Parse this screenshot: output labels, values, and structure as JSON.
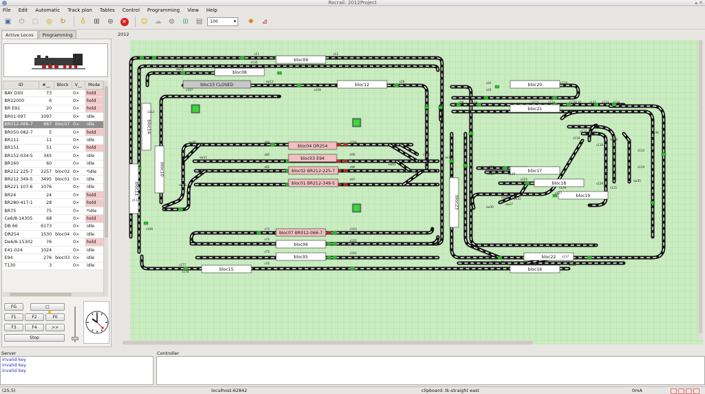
{
  "window": {
    "title": "Rocrail: 2012Project"
  },
  "menu": [
    "File",
    "Edit",
    "Automatic",
    "Track plan",
    "Tables",
    "Control",
    "Programming",
    "View",
    "Help"
  ],
  "toolbar": {
    "speed_value": "100"
  },
  "left_tabs": [
    "Active Locos",
    "Programming"
  ],
  "loco_table": {
    "headers": [
      "ID",
      "#__",
      "Block",
      "V__",
      "Mode"
    ],
    "rows": [
      {
        "id": "BAY DXII",
        "num": "73",
        "block": "",
        "v": "0>",
        "mode": "hold"
      },
      {
        "id": "BR12000",
        "num": "6",
        "block": "",
        "v": "0>",
        "mode": "hold"
      },
      {
        "id": "BR E91",
        "num": "20",
        "block": "",
        "v": "0>",
        "mode": "hold"
      },
      {
        "id": "BR01-097",
        "num": "1097",
        "block": "",
        "v": "0>",
        "mode": "idle"
      },
      {
        "id": "BR012-066-7",
        "num": "667",
        "block": "bloc07",
        "v": "0>",
        "mode": "idle"
      },
      {
        "id": "BR050-082-7",
        "num": "5",
        "block": "",
        "v": "0>",
        "mode": "hold"
      },
      {
        "id": "BR111",
        "num": "11",
        "block": "",
        "v": "0>",
        "mode": "idle"
      },
      {
        "id": "BR151",
        "num": "51",
        "block": "",
        "v": "0>",
        "mode": "hold"
      },
      {
        "id": "BR152-034-5",
        "num": "345",
        "block": "",
        "v": "0>",
        "mode": "idle"
      },
      {
        "id": "BR160",
        "num": "60",
        "block": "",
        "v": "0>",
        "mode": "idle"
      },
      {
        "id": "BR212 225-7",
        "num": "2257",
        "block": "bloc02",
        "v": "0>",
        "mode": "*idle"
      },
      {
        "id": "BR212 349-5",
        "num": "3495",
        "block": "bloc01",
        "v": "0>",
        "mode": "idle"
      },
      {
        "id": "BR221 107-6",
        "num": "1076",
        "block": "",
        "v": "0>",
        "mode": "idle"
      },
      {
        "id": "BR24",
        "num": "24",
        "block": "",
        "v": "0>",
        "mode": "hold"
      },
      {
        "id": "BR280-417-1",
        "num": "28",
        "block": "",
        "v": "0>",
        "mode": "hold"
      },
      {
        "id": "BR75",
        "num": "75",
        "block": "",
        "v": "0>",
        "mode": "*idle"
      },
      {
        "id": "Ce6/8-14305",
        "num": "68",
        "block": "",
        "v": "0>",
        "mode": "hold"
      },
      {
        "id": "DB 66",
        "num": "6173",
        "block": "",
        "v": "0>",
        "mode": "idle"
      },
      {
        "id": "DR254",
        "num": "1530",
        "block": "bloc04",
        "v": "0>",
        "mode": "idle"
      },
      {
        "id": "De6/6-15302",
        "num": "76",
        "block": "",
        "v": "0>",
        "mode": "hold"
      },
      {
        "id": "E41-024",
        "num": "1024",
        "block": "",
        "v": "0>",
        "mode": "idle"
      },
      {
        "id": "E94",
        "num": "276",
        "block": "bloc03",
        "v": "0>",
        "mode": "idle"
      },
      {
        "id": "T130",
        "num": "3",
        "block": "",
        "v": "0>",
        "mode": "idle"
      }
    ],
    "selected_index": 4
  },
  "controls": {
    "fg": "FG",
    "f1": "F1",
    "f2": "F2",
    "f0": "F0",
    "f3": "F3",
    "f4": "F4",
    "next": ">>",
    "stop": "Stop"
  },
  "plan": {
    "tab": "2012",
    "blocks": [
      {
        "id": "bloc09",
        "label": "bloc09",
        "state": "free"
      },
      {
        "id": "bloc08",
        "label": "bloc08",
        "state": "free"
      },
      {
        "id": "bloc13",
        "label": "bloc13 CLOSED",
        "state": "closed"
      },
      {
        "id": "bloc12",
        "label": "bloc12",
        "state": "free"
      },
      {
        "id": "bloc20",
        "label": "bloc20",
        "state": "free"
      },
      {
        "id": "bloc21",
        "label": "bloc21",
        "state": "free"
      },
      {
        "id": "bloc14",
        "label": "bloc14",
        "state": "free"
      },
      {
        "id": "bloc10",
        "label": "bloc10",
        "state": "free"
      },
      {
        "id": "bloc11",
        "label": "bloc11",
        "state": "free"
      },
      {
        "id": "bloc04",
        "label": "bloc04 DR254",
        "state": "occupied"
      },
      {
        "id": "bloc03",
        "label": "bloc03 E94",
        "state": "occupied"
      },
      {
        "id": "bloc02",
        "label": "bloc02 BR212-225-7",
        "state": "occupied"
      },
      {
        "id": "bloc01",
        "label": "bloc01 BR212-349-5",
        "state": "occupied"
      },
      {
        "id": "bloc07",
        "label": "bloc07 BR012-066-7",
        "state": "occupied"
      },
      {
        "id": "bloc06",
        "label": "bloc06",
        "state": "free"
      },
      {
        "id": "bloc05",
        "label": "bloc05",
        "state": "free"
      },
      {
        "id": "bloc15",
        "label": "bloc15",
        "state": "free"
      },
      {
        "id": "bloc23",
        "label": "bloc23",
        "state": "free"
      },
      {
        "id": "bloc17",
        "label": "bloc17",
        "state": "free"
      },
      {
        "id": "bloc18",
        "label": "bloc18",
        "state": "free"
      },
      {
        "id": "bloc19",
        "label": "bloc19",
        "state": "free"
      },
      {
        "id": "bloc22",
        "label": "bloc22",
        "state": "free"
      },
      {
        "id": "bloc16",
        "label": "bloc16",
        "state": "free"
      }
    ],
    "labels": {
      "s12": "s12",
      "s11": "s11",
      "s135": "s135",
      "sw14": "sw14",
      "s107": "s107",
      "sw13": "sw13",
      "s109": "s109",
      "s18": "s18",
      "s29": "s29",
      "s20": "s20",
      "s120": "s120",
      "s28": "s28",
      "s24": "s24",
      "sw06": "sw06",
      "sw11": "sw11",
      "sw16": "sw16",
      "s104": "s104",
      "s99": "s99",
      "s98": "s98",
      "s97": "s97",
      "s103": "s103",
      "s102": "s102",
      "s101": "s101",
      "s84": "s84",
      "s85": "s85",
      "s82": "s82",
      "sw04": "sw04",
      "s105": "s105",
      "sw23": "sw23",
      "s113": "s113",
      "s114": "s114",
      "s115": "s115",
      "s130": "s130",
      "s131": "s131",
      "s133": "s133",
      "s134": "s134",
      "s117": "s117",
      "s118": "s118",
      "s122": "s122",
      "s123": "s123",
      "s124": "s124",
      "s125": "s125",
      "s126": "s126",
      "s127": "s127",
      "s128": "s128",
      "s129": "s129",
      "s73": "s73",
      "s74": "s74",
      "s75": "s75",
      "s76": "s76",
      "sw20": "sw20",
      "sw21": "sw21",
      "sw27": "sw27",
      "sw28": "sw28",
      "sw30": "sw30",
      "sw31": "sw31",
      "s108": "s108",
      "s106": "s106",
      "s111": "s111",
      "s112": "s112",
      "s116": "s116",
      "s119": "s119",
      "s121": "s121",
      "s132": "s132",
      "sw18": "sw18",
      "sw19": "sw19",
      "sw35": "sw35",
      "sw36": "sw36",
      "s177": "s177",
      "s178": "s178",
      "s138": "s138",
      "s137": "s137"
    }
  },
  "server": {
    "title": "Server",
    "messages": [
      "invalid key",
      "invalid key",
      "invalid key"
    ]
  },
  "controller": {
    "title": "Controller"
  },
  "status": {
    "coords": "(25,5)",
    "host": "localhost:62842",
    "clipboard": "clipboard: tk-straight east",
    "current": "0mA"
  },
  "colors": {
    "plan_bg": "#c9ecc0",
    "grid": "#a9d69e",
    "block_occupied": "#f2c0c0",
    "block_free": "#ffffff",
    "block_closed": "#c8c8c8",
    "signal_green": "#2ec02e",
    "signal_red": "#d02020"
  }
}
